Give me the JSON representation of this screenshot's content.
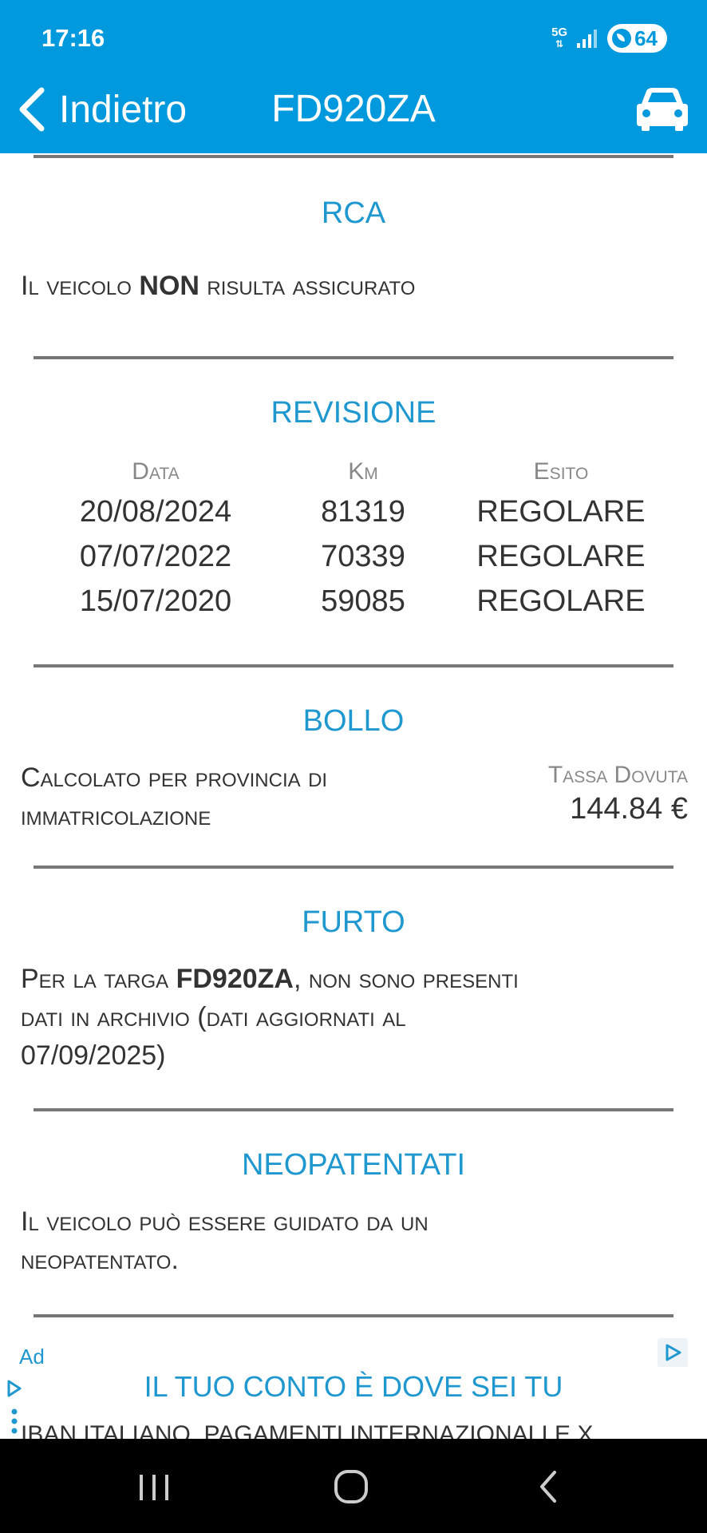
{
  "status_bar": {
    "time": "17:16",
    "network_label": "5G",
    "battery_level": "64"
  },
  "header": {
    "back_label": "Indietro",
    "title": "FD920ZA"
  },
  "sections": {
    "rca": {
      "title": "RCA",
      "text_before": "Il veicolo ",
      "text_bold": "NON",
      "text_after": " risulta assicurato"
    },
    "revisione": {
      "title": "REVISIONE",
      "columns": [
        "Data",
        "Km",
        "Esito"
      ],
      "rows": [
        [
          "20/08/2024",
          "81319",
          "REGOLARE"
        ],
        [
          "07/07/2022",
          "70339",
          "REGOLARE"
        ],
        [
          "15/07/2020",
          "59085",
          "REGOLARE"
        ]
      ]
    },
    "bollo": {
      "title": "BOLLO",
      "text_line1": "Calcolato per provincia di",
      "text_line2": "immatricolazione",
      "tax_label": "Tassa Dovuta",
      "tax_value": "144.84 €"
    },
    "furto": {
      "title": "FURTO",
      "line1_before": "Per la targa ",
      "plate": "FD920ZA",
      "line1_after": ", non sono presenti",
      "line2": "dati in archivio (dati aggiornati al",
      "line3": "07/09/2025)"
    },
    "neopatentati": {
      "title": "NEOPATENTATI",
      "line1": "Il veicolo può essere guidato da un",
      "line2": "neopatentato."
    }
  },
  "ad": {
    "label": "Ad",
    "title": "IL TUO CONTO È DOVE SEI TU",
    "subtitle": "IBAN ITALIANO, PAGAMENTI INTERNAZIONALI E X"
  },
  "colors": {
    "brand": "#0099dd",
    "section_title": "#1f97cf"
  }
}
